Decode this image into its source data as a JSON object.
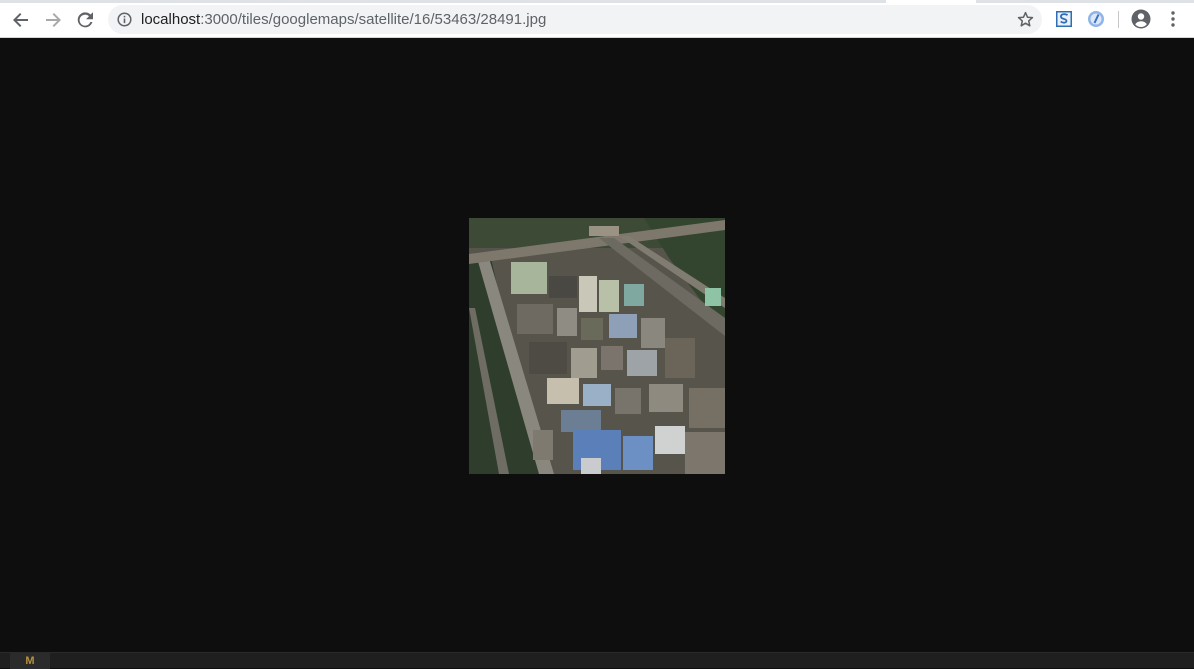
{
  "browser": {
    "address_bar": {
      "host": "localhost",
      "path": ":3000/tiles/googlemaps/satellite/16/53463/28491.jpg"
    },
    "icons": {
      "back": "arrow-left",
      "forward": "arrow-right",
      "reload": "reload",
      "info": "info-circle",
      "bookmark": "star-outline",
      "extension_1": "s-extension",
      "extension_2": "circle-extension",
      "profile": "account-circle",
      "menu": "three-dots-vertical"
    }
  },
  "viewer": {
    "background_color": "#0e0e0e",
    "image_alt": "satellite tile"
  },
  "bottom_bar": {
    "tab_label": "M"
  }
}
